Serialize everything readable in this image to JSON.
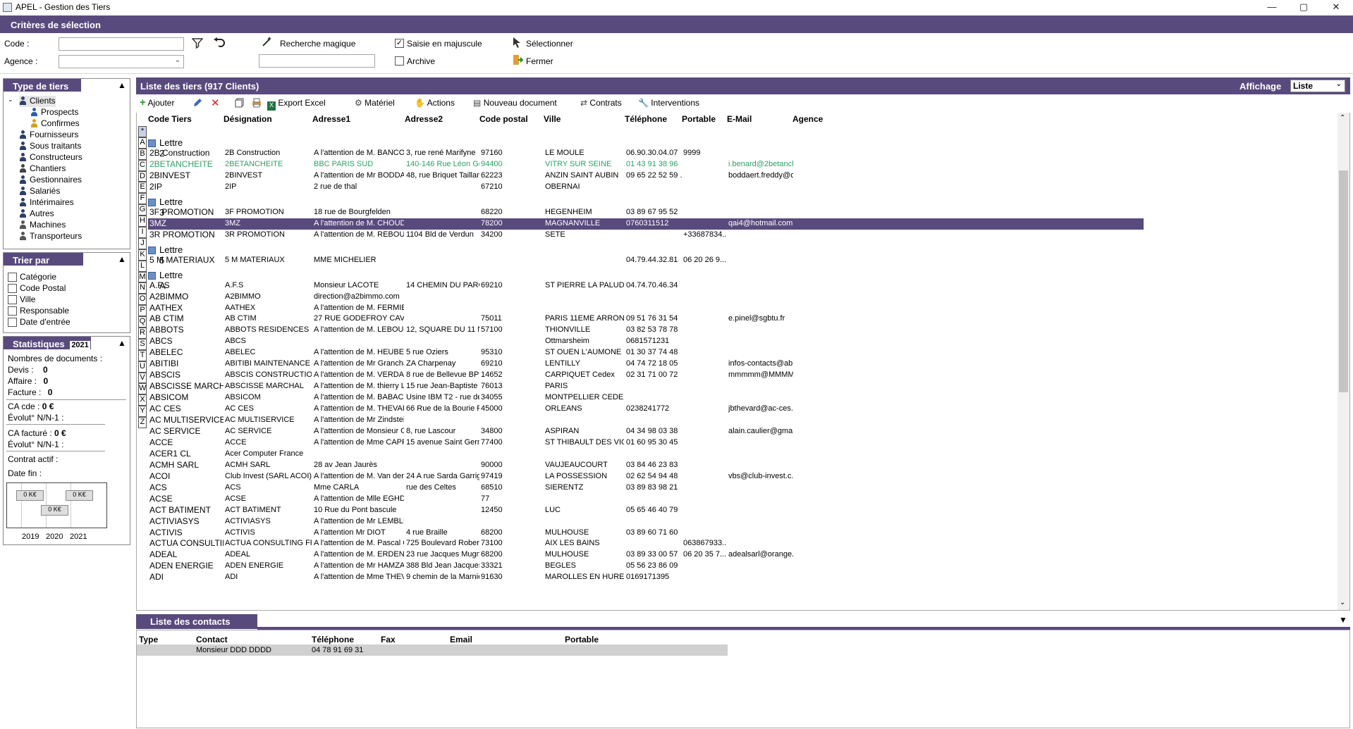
{
  "window": {
    "title": "APEL - Gestion des Tiers",
    "min": "—",
    "max": "▢",
    "close": "✕"
  },
  "criteria": {
    "header": "Critères de sélection",
    "code_label": "Code :",
    "agence_label": "Agence :",
    "code_value": "",
    "agence_value": "",
    "magic_label": "Recherche magique",
    "magic_value": "",
    "uppercase_label": "Saisie en majuscule",
    "uppercase_checked": true,
    "archive_label": "Archive",
    "archive_checked": false,
    "select_label": "Sélectionner",
    "close_label": "Fermer"
  },
  "tiers_types": {
    "header": "Type de tiers",
    "items": [
      {
        "label": "Clients",
        "level": 0
      },
      {
        "label": "Prospects",
        "level": 1
      },
      {
        "label": "Confirmes",
        "level": 1
      },
      {
        "label": "Fournisseurs",
        "level": 0
      },
      {
        "label": "Sous traitants",
        "level": 0
      },
      {
        "label": "Constructeurs",
        "level": 0
      },
      {
        "label": "Chantiers",
        "level": 0
      },
      {
        "label": "Gestionnaires",
        "level": 0
      },
      {
        "label": "Salariés",
        "level": 0
      },
      {
        "label": "Intérimaires",
        "level": 0
      },
      {
        "label": "Autres",
        "level": 0
      },
      {
        "label": "Machines",
        "level": 0
      },
      {
        "label": "Transporteurs",
        "level": 0
      }
    ]
  },
  "sort": {
    "header": "Trier par",
    "items": [
      "Catégorie",
      "Code Postal",
      "Ville",
      "Responsable",
      "Date d'entrée"
    ]
  },
  "stats": {
    "header": "Statistiques",
    "year": "2021",
    "docs_label": "Nombres de documents :",
    "devis_label": "Devis :",
    "devis": "0",
    "affaire_label": "Affaire :",
    "affaire": "0",
    "facture_label": "Facture :",
    "facture": "0",
    "ca_cde_label": "CA cde :",
    "ca_cde": "0 €",
    "evol1_label": "Évolut° N/N-1 :",
    "ca_fact_label": "CA facturé :",
    "ca_fact": "0 €",
    "evol2_label": "Évolut° N/N-1 :",
    "contract_label": "Contrat actif :",
    "end_label": "Date fin :",
    "chart": {
      "years": [
        "2019",
        "2020",
        "2021"
      ],
      "values": [
        "0 K€",
        "0 K€",
        "0 K€"
      ]
    }
  },
  "list": {
    "header": "Liste des tiers (917 Clients)",
    "display_label": "Affichage",
    "display_value": "Liste",
    "toolbar": {
      "add": "Ajouter",
      "export": "Export Excel",
      "material": "Matériel",
      "actions": "Actions",
      "newdoc": "Nouveau document",
      "contracts": "Contrats",
      "interventions": "Interventions"
    },
    "columns": [
      "Code Tiers",
      "Désignation",
      "Adresse1",
      "Adresse2",
      "Code postal",
      "Ville",
      "Téléphone",
      "Portable",
      "E-Mail",
      "Agence"
    ],
    "letters": [
      "*",
      "A",
      "B",
      "C",
      "D",
      "E",
      "F",
      "G",
      "H",
      "I",
      "J",
      "K",
      "L",
      "M",
      "N",
      "O",
      "P",
      "Q",
      "R",
      "S",
      "T",
      "U",
      "V",
      "W",
      "X",
      "Y",
      "Z"
    ],
    "rows": [
      {
        "g": "Lettre 2"
      },
      {
        "c": [
          "2B Construction",
          "2B Construction",
          "A l'attention de M. BANCO",
          "3, rue rené Marifyne",
          "97160",
          "LE MOULE",
          "06.90.30.04.07",
          "9999",
          "",
          ""
        ]
      },
      {
        "c": [
          "2BETANCHEITE",
          "2BETANCHEITE",
          "BBC PARIS SUD",
          "140-146 Rue Léon Ge...",
          "94400",
          "VITRY SUR SEINE",
          "01 43 91 38 96",
          "",
          "i.benard@2betanch...",
          ""
        ],
        "green": true
      },
      {
        "c": [
          "2BINVEST",
          "2BINVEST",
          "A l'attention de Mr BODDAE...",
          "48, rue Briquet Taillan...",
          "62223",
          "ANZIN SAINT AUBIN",
          "09 65 22 52 59 ...",
          "",
          "boddaert.freddy@or...",
          ""
        ]
      },
      {
        "c": [
          "2IP",
          "2IP",
          "2 rue de thal",
          "",
          "67210",
          "OBERNAI",
          "",
          "",
          "",
          ""
        ]
      },
      {
        "g": "Lettre 3"
      },
      {
        "c": [
          "3F PROMOTION",
          "3F PROMOTION",
          "18 rue de Bourgfelden",
          "",
          "68220",
          "HEGENHEIM",
          "03 89 67 95 52",
          "",
          "",
          ""
        ]
      },
      {
        "c": [
          "3MZ",
          "3MZ",
          "A l'attention de M. CHOUDH...",
          "",
          "78200",
          "MAGNANVILLE",
          "0760311512",
          "",
          "qai4@hotmail.com",
          ""
        ],
        "sel": true
      },
      {
        "c": [
          "3R PROMOTION",
          "3R PROMOTION",
          "A l'attention de M. REBOUL",
          "1104 Bld de Verdun",
          "34200",
          "SETE",
          "",
          "+33687834...",
          "",
          ""
        ]
      },
      {
        "g": "Lettre 5"
      },
      {
        "c": [
          "5 M MATERIAUX",
          "5 M MATERIAUX",
          "MME MICHELIER",
          "",
          "",
          "",
          "04.79.44.32.81",
          "06 20 26 9...",
          "",
          ""
        ]
      },
      {
        "g": "Lettre A"
      },
      {
        "c": [
          "A.F.S",
          "A.F.S",
          "Monsieur LACOTE",
          "14 CHEMIN DU PARG...",
          "69210",
          "ST PIERRE LA PALUD",
          "04.74.70.46.34",
          "",
          "",
          ""
        ]
      },
      {
        "c": [
          "A2BIMMO",
          "A2BIMMO",
          "direction@a2bimmo.com",
          "",
          "",
          "",
          "",
          "",
          "",
          ""
        ]
      },
      {
        "c": [
          "AATHEX",
          "AATHEX",
          "A l'attention de M. FERMIER",
          "",
          "",
          "",
          "",
          "",
          "",
          ""
        ]
      },
      {
        "c": [
          "AB CTIM",
          "AB CTIM",
          "27 RUE GODEFROY CAVAI...",
          "",
          "75011",
          "PARIS 11EME ARROND...",
          "09 51 76 31 54",
          "",
          "e.pinel@sgbtu.fr",
          ""
        ]
      },
      {
        "c": [
          "ABBOTS",
          "ABBOTS RESIDENCES",
          "A l'attention de M. LEBOUC...",
          "12, SQUARE DU 11 N...",
          "57100",
          "THIONVILLE",
          "03 82 53 78 78",
          "",
          "",
          ""
        ]
      },
      {
        "c": [
          "ABCS",
          "ABCS",
          "",
          "",
          "",
          "Ottmarsheim",
          "0681571231",
          "",
          "",
          ""
        ]
      },
      {
        "c": [
          "ABELEC",
          "ABELEC",
          "A l'attention de M. HEUBER...",
          "5 rue Oziers",
          "95310",
          "ST OUEN L'AUMONE",
          "01 30 37 74 48",
          "",
          "",
          ""
        ]
      },
      {
        "c": [
          "ABITIBI",
          "ABITIBI MAINTENANCE",
          "A l'attention de Mr Grancha...",
          "ZA Charpenay",
          "69210",
          "LENTILLY",
          "04 74 72 18 05",
          "",
          "infos-contacts@abi...",
          ""
        ]
      },
      {
        "c": [
          "ABSCIS",
          "ABSCIS CONSTRUCTION",
          "A l'attention de M. VERDAN...",
          "8 rue de Bellevue BP 3...",
          "14652",
          "CARPIQUET Cedex",
          "02 31 71 00 72",
          "",
          "mmmmm@MMMM....",
          ""
        ]
      },
      {
        "c": [
          "ABSCISSE MARCHA...",
          "ABSCISSE MARCHAL",
          "A l'attention de M. thierry LU...",
          "15 rue Jean-Baptiste ...",
          "76013",
          "PARIS",
          "",
          "",
          "",
          ""
        ]
      },
      {
        "c": [
          "ABSICOM",
          "ABSICOM",
          "A l'attention de M. BABACI",
          "Usine IBM T2 - rue de ...",
          "34055",
          "MONTPELLIER CEDEX ...",
          "",
          "",
          "",
          ""
        ]
      },
      {
        "c": [
          "AC CES",
          "AC CES",
          "A l'attention de M. THEVAR...",
          "66 Rue de la Bourie Ro...",
          "45000",
          "ORLEANS",
          "0238241772",
          "",
          "jbthevard@ac-ces....",
          ""
        ]
      },
      {
        "c": [
          "AC MULTISERVICE",
          "AC MULTISERVICE",
          "A l'attention de Mr Zindstein...",
          "",
          "",
          "",
          "",
          "",
          "",
          ""
        ]
      },
      {
        "c": [
          "AC SERVICE",
          "AC SERVICE",
          "A l'attention de Monsieur CA...",
          "8, rue Lascour",
          "34800",
          "ASPIRAN",
          "04 34 98 03 38",
          "",
          "alain.caulier@gmail...",
          ""
        ]
      },
      {
        "c": [
          "ACCE",
          "ACCE",
          "A l'attention de Mme CAPR...",
          "15 avenue Saint Germ...",
          "77400",
          "ST THIBAULT DES VIG...",
          "01 60 95 30 45",
          "",
          "",
          ""
        ]
      },
      {
        "c": [
          "ACER1 CL",
          "Acer Computer France",
          "",
          "",
          "",
          "",
          "",
          "",
          "",
          ""
        ]
      },
      {
        "c": [
          "ACMH SARL",
          "ACMH SARL",
          "28 av Jean Jaurès",
          "",
          "90000",
          "VAUJEAUCOURT",
          "03 84 46 23 83",
          "",
          "",
          ""
        ]
      },
      {
        "c": [
          "ACOI",
          "Club Invest (SARL ACOI)",
          "A l'attention de M. Van der s...",
          "24 A rue Sarda Garrig...",
          "97419",
          "LA POSSESSION",
          "02 62 54 94 48",
          "",
          "vbs@club-invest.c...",
          ""
        ]
      },
      {
        "c": [
          "ACS",
          "ACS",
          "Mme CARLA",
          "rue des Celtes",
          "68510",
          "SIERENTZ",
          "03 89 83 98 21",
          "",
          "",
          ""
        ]
      },
      {
        "c": [
          "ACSE",
          "ACSE",
          "A l'attention de  Mlle EGHD...",
          "",
          "77",
          "",
          "",
          "",
          "",
          ""
        ]
      },
      {
        "c": [
          "ACT BATIMENT",
          "ACT BATIMENT",
          "10 Rue du Pont bascule",
          "",
          "12450",
          "LUC",
          "05 65 46 40 79",
          "",
          "",
          ""
        ]
      },
      {
        "c": [
          "ACTIVIASYS",
          "ACTIVIASYS",
          "A l'attention de Mr LEMBLIN",
          "",
          "",
          "",
          "",
          "",
          "",
          ""
        ]
      },
      {
        "c": [
          "ACTIVIS",
          "ACTIVIS",
          "A l'attention Mr DIOT",
          "4 rue Braille",
          "68200",
          "MULHOUSE",
          "03 89 60 71 60",
          "",
          "",
          ""
        ]
      },
      {
        "c": [
          "ACTUA CONSULTIN...",
          "ACTUA CONSULTING FRA...",
          "A l'attention de M. Pascal G...",
          "725 Boulevard Robert ...",
          "73100",
          "AIX LES BAINS",
          "",
          "063867933...",
          "",
          ""
        ]
      },
      {
        "c": [
          "ADEAL",
          "ADEAL",
          "A l'attention de M. ERDEN",
          "23 rue Jacques Mugni...",
          "68200",
          "MULHOUSE",
          "03 89 33 00 57",
          "06 20 35 7...",
          "adealsarl@orange.f...",
          ""
        ]
      },
      {
        "c": [
          "ADEN ENERGIE",
          "ADEN ENERGIE",
          "A l'attention de Mr HAMZA",
          "388 Bld Jean Jacques ...",
          "33321",
          "BEGLES",
          "05 56 23 86 09",
          "",
          "",
          ""
        ]
      },
      {
        "c": [
          "ADI",
          "ADI",
          "A l'attention de Mme THEVE...",
          "9 chemin de la Marnièr...",
          "91630",
          "MAROLLES EN HUREP...",
          "0169171395",
          "",
          "",
          ""
        ]
      }
    ]
  },
  "contacts": {
    "header": "Liste des contacts",
    "columns": [
      "Type",
      "Contact",
      "Téléphone",
      "Fax",
      "Email",
      "Portable"
    ],
    "rows": [
      {
        "type": "",
        "contact": "Monsieur DDD DDDD",
        "phone": "04 78 91 69 31",
        "fax": "",
        "email": "",
        "mobile": ""
      }
    ]
  }
}
